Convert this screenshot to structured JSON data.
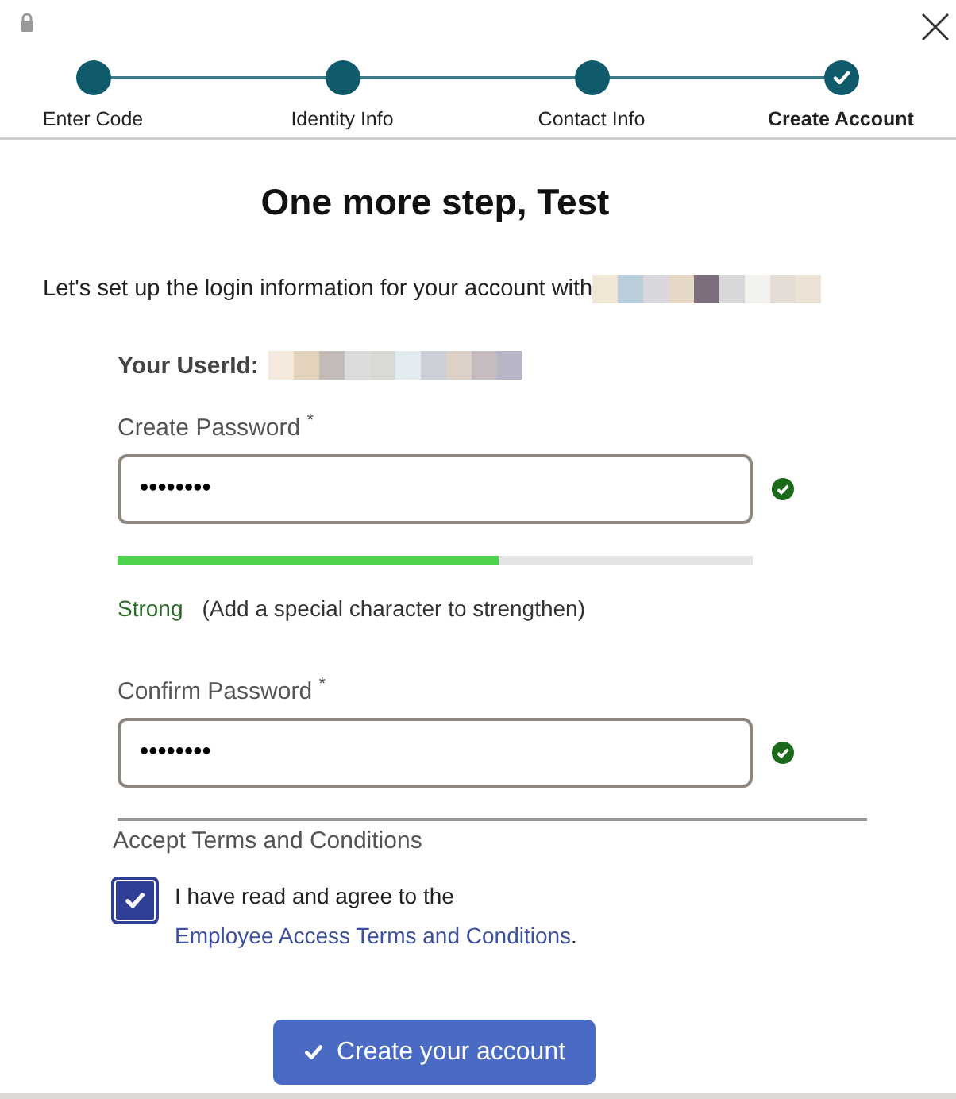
{
  "steps": [
    {
      "label": "Enter Code",
      "selected": false
    },
    {
      "label": "Identity Info",
      "selected": false
    },
    {
      "label": "Contact Info",
      "selected": false
    },
    {
      "label": "Create Account",
      "selected": true
    }
  ],
  "title": "One more step, Test",
  "intro": "Let's set up the login information for your account with",
  "userid_label": "Your UserId:",
  "password": {
    "label": "Create Password",
    "required_mark": "*",
    "value": "••••••••",
    "valid": true
  },
  "strength": {
    "level": 0.6,
    "label": "Strong",
    "hint": "(Add a special character to strengthen)"
  },
  "confirm": {
    "label": "Confirm Password",
    "required_mark": "*",
    "value": "••••••••",
    "valid": true
  },
  "terms": {
    "heading": "Accept Terms and Conditions",
    "checked": true,
    "text": "I have read and agree to the",
    "link": "Employee Access Terms and Conditions",
    "end": "."
  },
  "submit": {
    "label": "Create your account"
  }
}
